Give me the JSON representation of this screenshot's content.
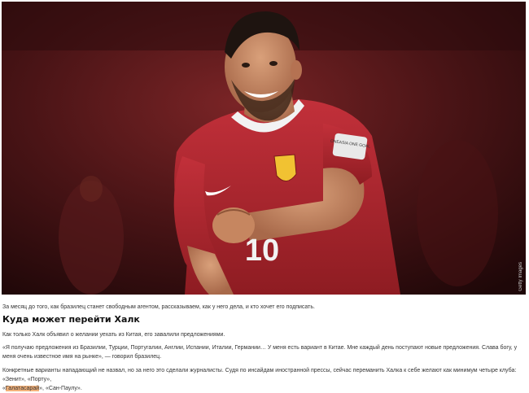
{
  "article": {
    "photo": {
      "alt": "Халк празднует гол",
      "credit": "Getty Images",
      "jersey_number": "10",
      "sleeve_patch": "ONEASIA ONE GOAL"
    },
    "lead": "За месяц до того, как бразилец станет свободным агентом, рассказываем, как у него дела, и кто хочет его подписать.",
    "heading": "Куда может перейти Халк",
    "p1": "Как только Халк объявил о желании уехать из Китая, его завалили предложениями.",
    "quote": "«Я получаю предложения из Бразилии, Турции, Португалии, Англии, Испании, Италии, Германии… У меня есть вариант в Китае. Мне каждый день поступают новые предложения. Слава богу, у меня очень известное имя на рынке», — говорил бразилец.",
    "p3_start": "Конкретные варианты нападающий не назвал, но за него это сделали журналисты. Судя по инсайдам иностранной прессы, сейчас переманить Халка к себе желают как минимум четыре клуба: «Зенит», «Порту»,",
    "clubs": {
      "open": "«",
      "galatasaray": "Галатасарай",
      "close_sep": "», ",
      "sao_paulo": "«Сан-Паулу»",
      "end": "."
    }
  },
  "colors": {
    "jersey": "#b3262c",
    "background_dark": "#3a1012",
    "highlight": "#f3b27b"
  }
}
